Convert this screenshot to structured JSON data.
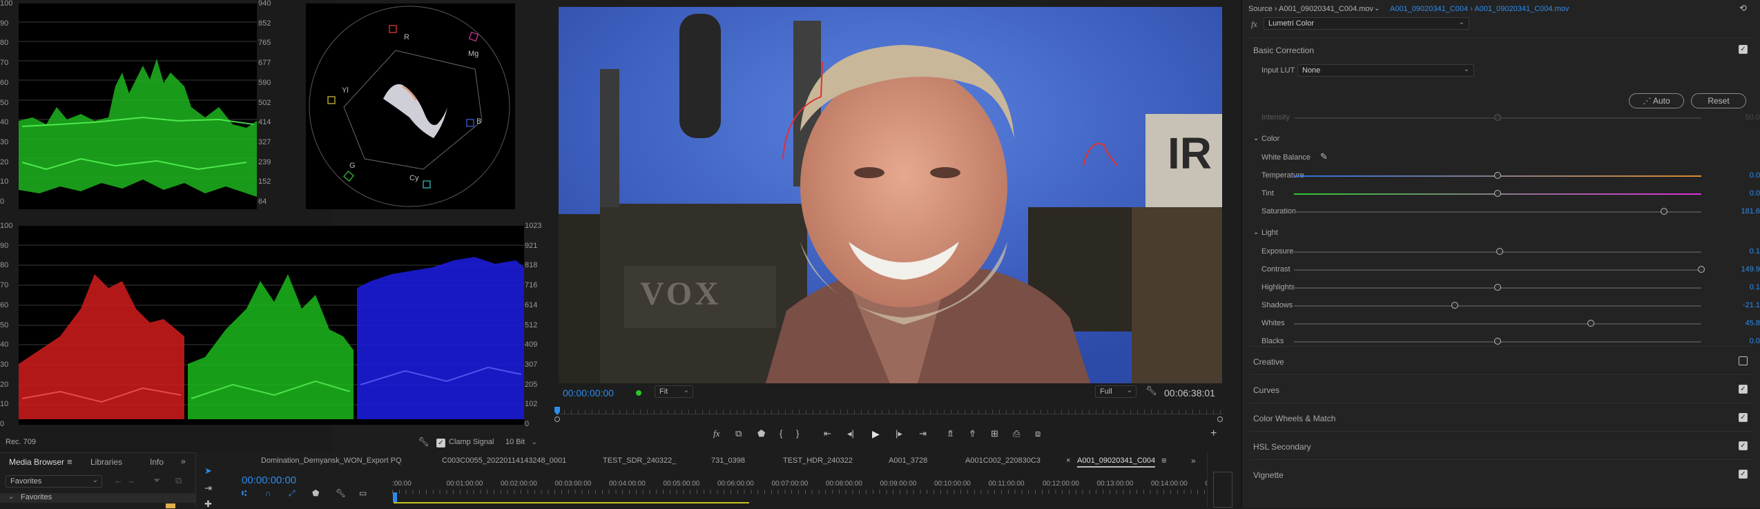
{
  "scopes": {
    "waveform_top_ticks_left": [
      "100",
      "90",
      "80",
      "70",
      "60",
      "50",
      "40",
      "30",
      "20",
      "10",
      "0"
    ],
    "waveform_top_ticks_right": [
      "940",
      "852",
      "765",
      "677",
      "590",
      "502",
      "414",
      "327",
      "239",
      "152",
      "64"
    ],
    "parade_ticks_left": [
      "100",
      "90",
      "80",
      "70",
      "60",
      "50",
      "40",
      "30",
      "20",
      "10",
      "0"
    ],
    "parade_ticks_right": [
      "1023",
      "921",
      "818",
      "716",
      "614",
      "512",
      "409",
      "307",
      "205",
      "102",
      "0"
    ],
    "vector_labels": [
      "R",
      "Mg",
      "B",
      "Cy",
      "G",
      "Yl"
    ],
    "footer_left": "Rec. 709",
    "clamp_label": "Clamp Signal",
    "bit_depth": "10 Bit"
  },
  "program": {
    "timecode": "00:00:00:00",
    "fit": "Fit",
    "quality": "Full",
    "duration": "00:06:38:01",
    "fx_label": "fx",
    "overlay_text": "VOX",
    "box_text": "IR"
  },
  "media_browser": {
    "tabs": [
      "Media Browser",
      "Libraries",
      "Info"
    ],
    "more": "»",
    "location": "Favorites",
    "tree_item": "Favorites"
  },
  "timeline": {
    "tabs": [
      "Domination_Demyansk_WON_Export PQ",
      "C003C0055_20220114143248_0001",
      "TEST_SDR_240322_",
      "731_0398",
      "TEST_HDR_240322",
      "A001_3728",
      "A001C002_220830C3",
      "A001_09020341_C004"
    ],
    "more": "»",
    "timecode": "00:00:00:00",
    "ruler": [
      ":00:00",
      "00:01:00:00",
      "00:02:00:00",
      "00:03:00:00",
      "00:04:00:00",
      "00:05:00:00",
      "00:06:00:00",
      "00:07:00:00",
      "00:08:00:00",
      "00:09:00:00",
      "00:10:00:00",
      "00:11:00:00",
      "00:12:00:00",
      "00:13:00:00",
      "00:14:00:00",
      "0"
    ]
  },
  "lumetri": {
    "source": "Source › A001_09020341_C004.mov",
    "clip": "A001_09020341_C004 › A001_09020341_C004.mov",
    "effect": "Lumetri Color",
    "fx": "fx",
    "basic_correction": "Basic Correction",
    "input_lut_label": "Input LUT",
    "input_lut_value": "None",
    "auto": "Auto",
    "reset": "Reset",
    "intensity_label": "Intensity",
    "intensity_value": "50.0",
    "color_section": "Color",
    "white_balance": "White Balance",
    "light_section": "Light",
    "color_params": [
      {
        "label": "Temperature",
        "value": "0.0",
        "pos": 0.5
      },
      {
        "label": "Tint",
        "value": "0.0",
        "pos": 0.5
      },
      {
        "label": "Saturation",
        "value": "181.6",
        "pos": 0.908
      }
    ],
    "light_params": [
      {
        "label": "Exposure",
        "value": "0.1",
        "pos": 0.505
      },
      {
        "label": "Contrast",
        "value": "149.9",
        "pos": 1.0
      },
      {
        "label": "Highlights",
        "value": "0.1",
        "pos": 0.5
      },
      {
        "label": "Shadows",
        "value": "-21.1",
        "pos": 0.395
      },
      {
        "label": "Whites",
        "value": "45.8",
        "pos": 0.729
      },
      {
        "label": "Blacks",
        "value": "0.0",
        "pos": 0.5
      }
    ],
    "sections": [
      "Creative",
      "Curves",
      "Color Wheels & Match",
      "HSL Secondary",
      "Vignette"
    ],
    "sections_checked": [
      false,
      true,
      true,
      true,
      true
    ]
  },
  "colors": {
    "accent": "#2d8ceb",
    "bg": "#1d1d1d",
    "panel": "#232323"
  }
}
